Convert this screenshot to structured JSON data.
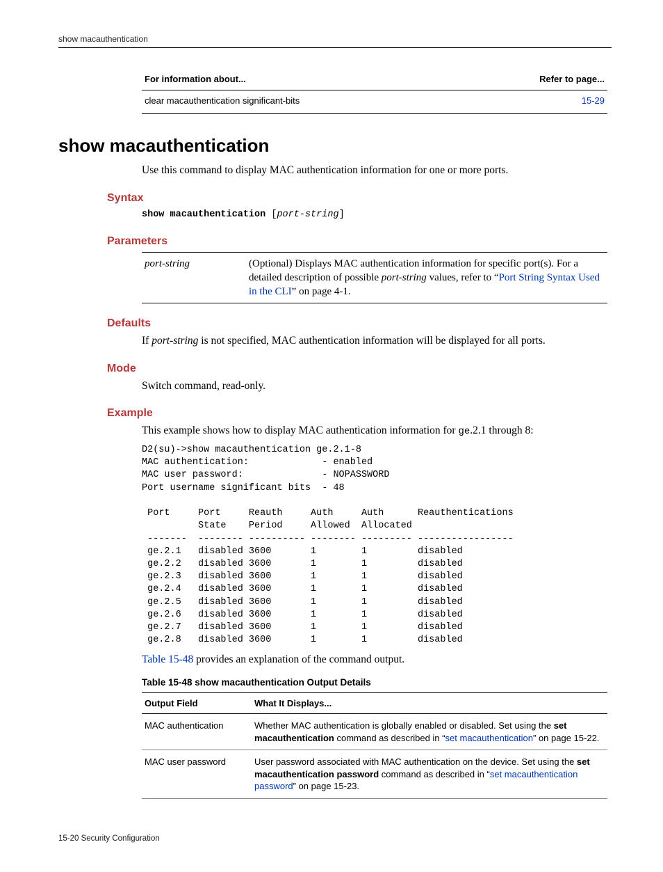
{
  "running_header": "show macauthentication",
  "ref_table": {
    "headers": {
      "left": "For information about...",
      "right": "Refer to page..."
    },
    "row": {
      "left": "clear macauthentication significant-bits",
      "right": "15-29"
    }
  },
  "title": "show macauthentication",
  "intro": "Use this command to display MAC authentication information for one or more ports.",
  "sections": {
    "syntax": "Syntax",
    "parameters": "Parameters",
    "defaults": "Defaults",
    "mode": "Mode",
    "example": "Example"
  },
  "syntax_cmd": {
    "kw": "show macauthentication",
    "open": " [",
    "arg": "port-string",
    "close": "]"
  },
  "param_row": {
    "name": "port-string",
    "desc_line1": "(Optional) Displays MAC authentication information for specific port(s). For a detailed description of possible ",
    "desc_em": "port-string",
    "desc_mid": " values, refer to “",
    "desc_link": "Port String Syntax Used in the CLI",
    "desc_tail": "” on page 4-1."
  },
  "defaults_text": {
    "pre": "If ",
    "em": "port-string",
    "post": " is not specified, MAC authentication information will be displayed for all ports."
  },
  "mode_text": "Switch command, read-only.",
  "example_intro": {
    "pre": "This example shows how to display MAC authentication information for ",
    "mono": "ge",
    "post": ".2.1 through 8:"
  },
  "cli_output": "D2(su)->show macauthentication ge.2.1-8\nMAC authentication:             - enabled\nMAC user password:              - NOPASSWORD\nPort username significant bits  - 48\n\n Port     Port     Reauth     Auth     Auth      Reauthentications\n          State    Period     Allowed  Allocated\n -------  -------- ---------- -------- --------- -----------------\n ge.2.1   disabled 3600       1        1         disabled\n ge.2.2   disabled 3600       1        1         disabled\n ge.2.3   disabled 3600       1        1         disabled\n ge.2.4   disabled 3600       1        1         disabled\n ge.2.5   disabled 3600       1        1         disabled\n ge.2.6   disabled 3600       1        1         disabled\n ge.2.7   disabled 3600       1        1         disabled\n ge.2.8   disabled 3600       1        1         disabled",
  "post_cli": {
    "link": "Table 15-48",
    "tail": " provides an explanation of the command output."
  },
  "output_table": {
    "caption": "Table 15-48    show macauthentication Output Details",
    "headers": {
      "field": "Output Field",
      "desc": "What It Displays..."
    },
    "rows": [
      {
        "field": "MAC authentication",
        "desc_pre": "Whether MAC authentication is globally enabled or disabled. Set using the ",
        "desc_b1": "set macauthentication",
        "desc_mid": " command as described in “",
        "desc_link": "set macauthentication",
        "desc_tail": "” on page 15-22."
      },
      {
        "field": "MAC user password",
        "desc_pre": "User password associated with MAC authentication on the device. Set using the ",
        "desc_b1": "set macauthentication password",
        "desc_mid": " command as described in “",
        "desc_link": "set macauthentication password",
        "desc_tail": "” on page 15-23."
      }
    ]
  },
  "footer": "15-20   Security Configuration"
}
